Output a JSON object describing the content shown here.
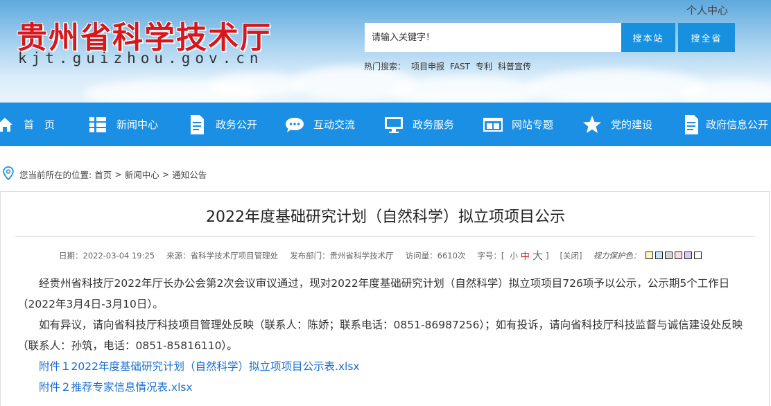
{
  "header": {
    "site_title": "贵州省科学技术厅",
    "site_domain": "kjt.guizhou.gov.cn",
    "personal_center": "个人中心",
    "search_placeholder": "请输入关键字！",
    "btn_search_site": "搜本站",
    "btn_search_all": "搜全省",
    "hot_search_label": "热门搜索：",
    "hot_search_items": [
      "项目申报",
      "FAST",
      "专利",
      "科普宣传"
    ]
  },
  "nav": {
    "items": [
      {
        "label": "首　页",
        "icon": "home-icon"
      },
      {
        "label": "新闻中心",
        "icon": "news-list-icon"
      },
      {
        "label": "政务公开",
        "icon": "document-icon"
      },
      {
        "label": "互动交流",
        "icon": "chat-bubble-icon"
      },
      {
        "label": "政务服务",
        "icon": "monitor-icon"
      },
      {
        "label": "网站专题",
        "icon": "browser-window-icon"
      },
      {
        "label": "党的建设",
        "icon": "star-icon"
      },
      {
        "label": "政府信息公开",
        "icon": "document-icon"
      }
    ]
  },
  "breadcrumb": {
    "prefix": "您当前所在的位置:",
    "items": [
      "首页",
      "新闻中心",
      "通知公告"
    ],
    "separator": ">"
  },
  "article": {
    "title": "2022年度基础研究计划（自然科学）拟立项项目公示",
    "meta": {
      "date": "日期：2022-03-04 19:25",
      "source": "来源：省科学技术厅项目管理处",
      "department": "发布部门：贵州省科学技术厅",
      "views": "访问量：6610次",
      "font_size_label": "字号：[",
      "size_small": "小",
      "size_medium": "中",
      "size_large": "大",
      "font_size_end": "]",
      "close": "[关闭]",
      "eye_protection_label": "视力保护色：",
      "swatch_colors": [
        "#fdf6c3",
        "#c7e3f4",
        "#cfd6dc",
        "#fbd9e6",
        "#dcc8f5",
        "#ffffff"
      ]
    },
    "paragraphs": [
      "经贵州省科技厅2022年厅长办公会第2次会议审议通过，现对2022年度基础研究计划（自然科学）拟立项项目726项予以公示，公示期5个工作日（2022年3月4日-3月10日）。",
      "如有异议，请向省科技厅科技项目管理处反映（联系人：陈娇；联系电话：0851-86987256）；如有投诉，请向省科技厅科技监督与诚信建设处反映（联系人：孙筑，电话：0851-85816110）。"
    ],
    "attachments": [
      "附件１2022年度基础研究计划（自然科学）拟立项项目公示表.xlsx",
      "附件２推荐专家信息情况表.xlsx"
    ]
  },
  "colors": {
    "nav_background": "#1a8fe3",
    "title_red": "#d6181e",
    "button_blue": "#1790e0",
    "link_blue": "#1a6fcf"
  }
}
